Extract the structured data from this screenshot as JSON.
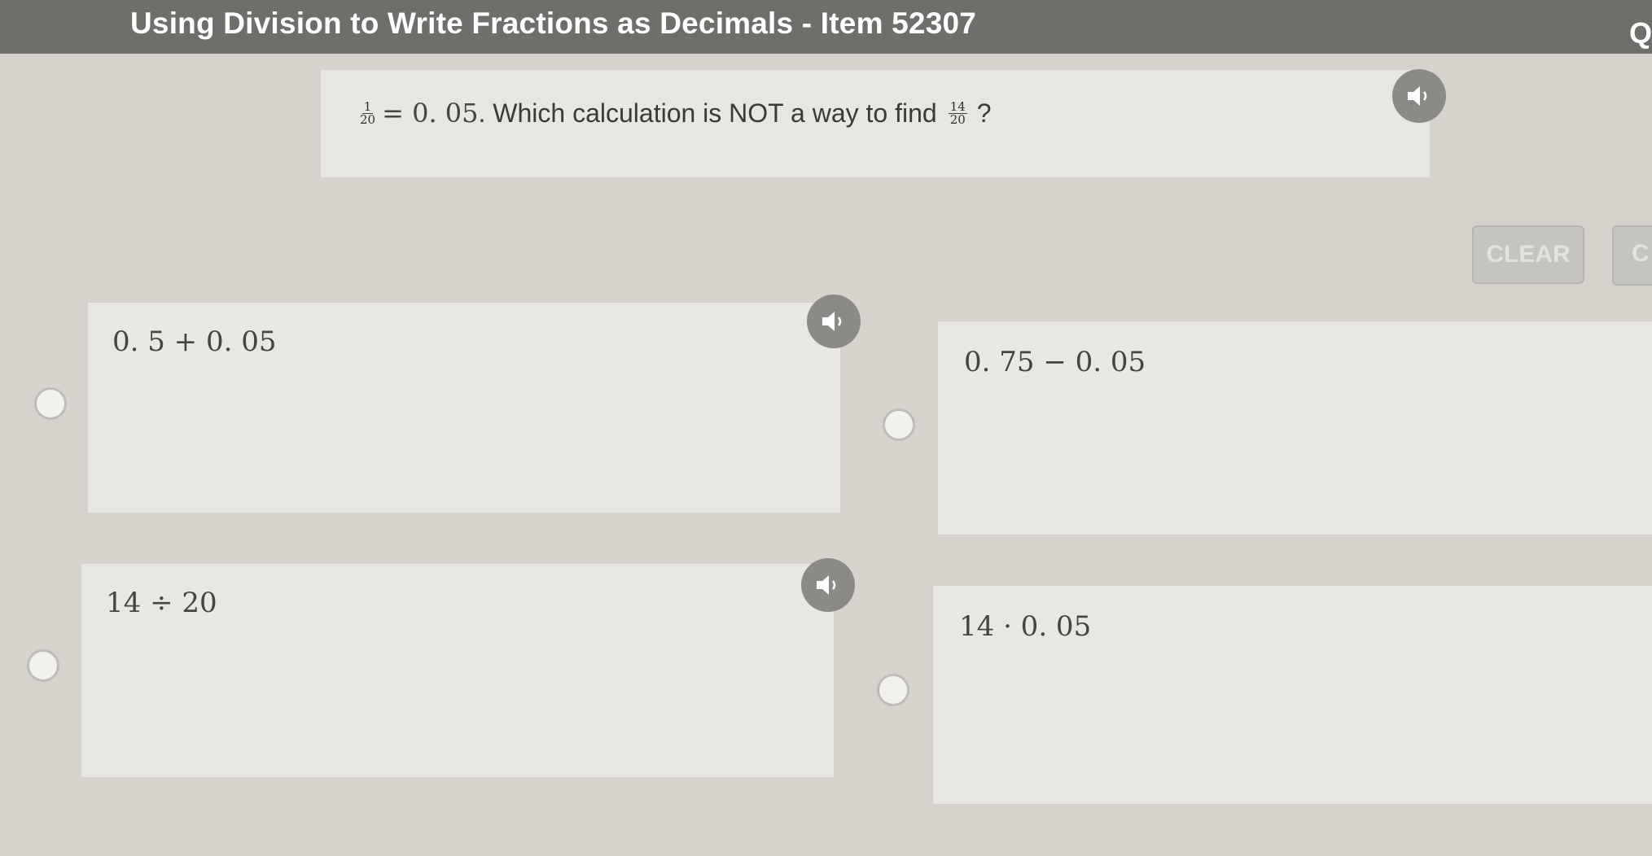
{
  "header": {
    "title": "Using Division to Write Fractions as Decimals - Item 52307",
    "right_text": "Q"
  },
  "question": {
    "frac1": {
      "num": "1",
      "den": "20"
    },
    "equals": "= 0. 05",
    "text": ". Which calculation is NOT a way to find",
    "frac2": {
      "num": "14",
      "den": "20"
    },
    "end": "?"
  },
  "buttons": {
    "clear_label": "CLEAR",
    "next_label": "C"
  },
  "choices": [
    {
      "label": "0. 5 + 0. 05"
    },
    {
      "label": "0. 75 − 0. 05"
    },
    {
      "label": "14 ÷ 20"
    },
    {
      "label": "14 · 0. 05"
    }
  ],
  "icons": {
    "speaker": "speaker-icon",
    "radio": "radio-button"
  },
  "colors": {
    "title_bar": "#6f6e6b",
    "background": "#d5d3cc",
    "card": "#e9e7e1"
  }
}
